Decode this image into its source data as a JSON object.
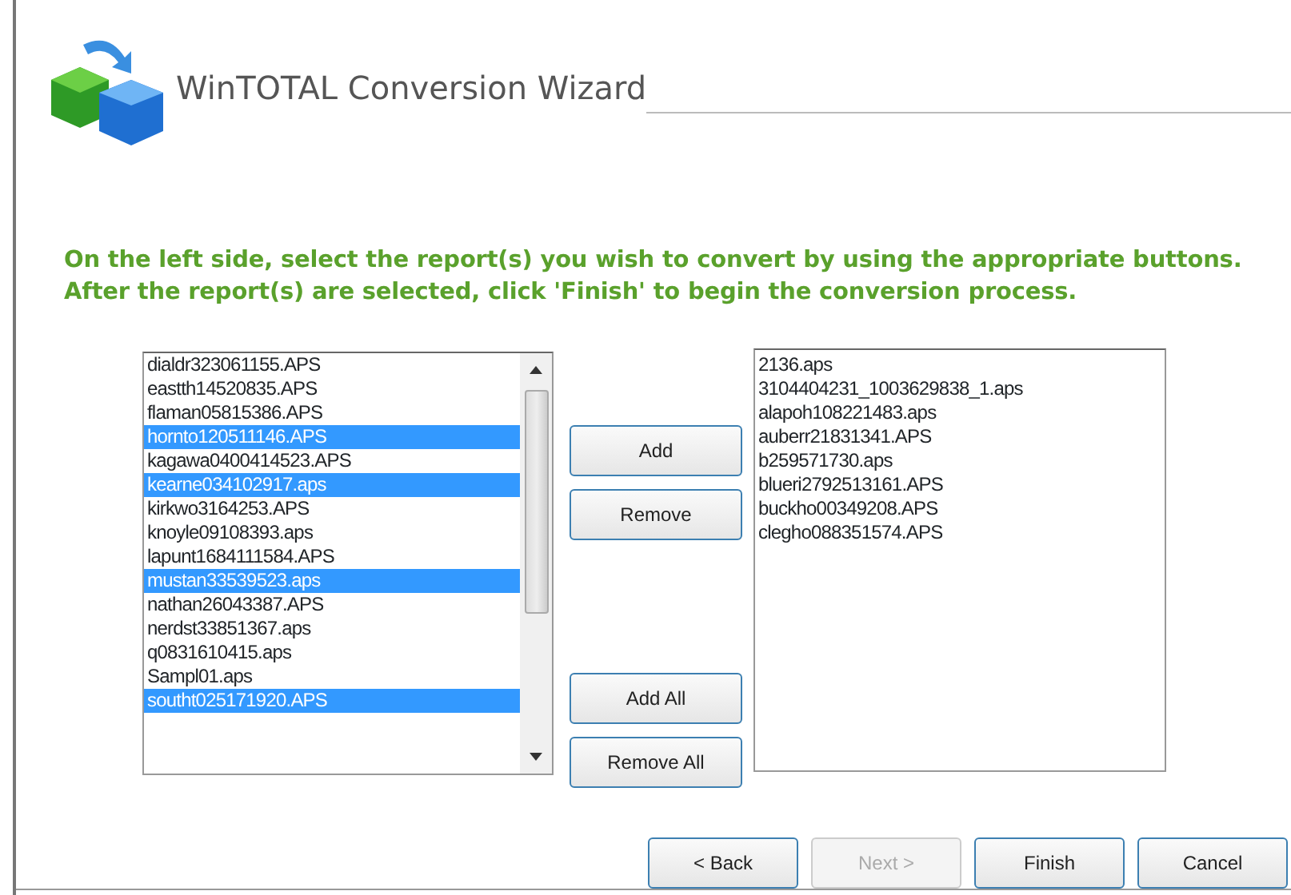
{
  "window": {
    "title": "WinTOTAL Conversion Wizard"
  },
  "instructions": "On the left side, select the report(s) you wish to convert by using the appropriate buttons.  After the report(s) are selected, click 'Finish' to begin the conversion process.",
  "available_reports": [
    {
      "name": "dialdr323061155.APS",
      "selected": false
    },
    {
      "name": "eastth14520835.APS",
      "selected": false
    },
    {
      "name": "flaman05815386.APS",
      "selected": false
    },
    {
      "name": "hornto120511146.APS",
      "selected": true
    },
    {
      "name": "kagawa0400414523.APS",
      "selected": false
    },
    {
      "name": "kearne034102917.aps",
      "selected": true
    },
    {
      "name": "kirkwo3164253.APS",
      "selected": false
    },
    {
      "name": "knoyle09108393.aps",
      "selected": false
    },
    {
      "name": "lapunt1684111584.APS",
      "selected": false
    },
    {
      "name": "mustan33539523.aps",
      "selected": true
    },
    {
      "name": "nathan26043387.APS",
      "selected": false
    },
    {
      "name": "nerdst33851367.aps",
      "selected": false
    },
    {
      "name": "q0831610415.aps",
      "selected": false
    },
    {
      "name": "Sampl01.aps",
      "selected": false
    },
    {
      "name": "southt025171920.APS",
      "selected": true
    }
  ],
  "transfer_buttons": [
    {
      "label": "Add"
    },
    {
      "label": "Remove"
    },
    {
      "label": "Add All"
    },
    {
      "label": "Remove All"
    }
  ],
  "selected_reports": [
    "2136.aps",
    "3104404231_1003629838_1.aps",
    "alapoh108221483.aps",
    "auberr21831341.APS",
    "b259571730.aps",
    "blueri2792513161.APS",
    "buckho00349208.APS",
    "clegho088351574.APS"
  ],
  "nav_buttons": [
    {
      "label": "< Back",
      "disabled": false
    },
    {
      "label": "Next >",
      "disabled": true
    },
    {
      "label": "Finish",
      "disabled": false
    },
    {
      "label": "Cancel",
      "disabled": false
    }
  ]
}
